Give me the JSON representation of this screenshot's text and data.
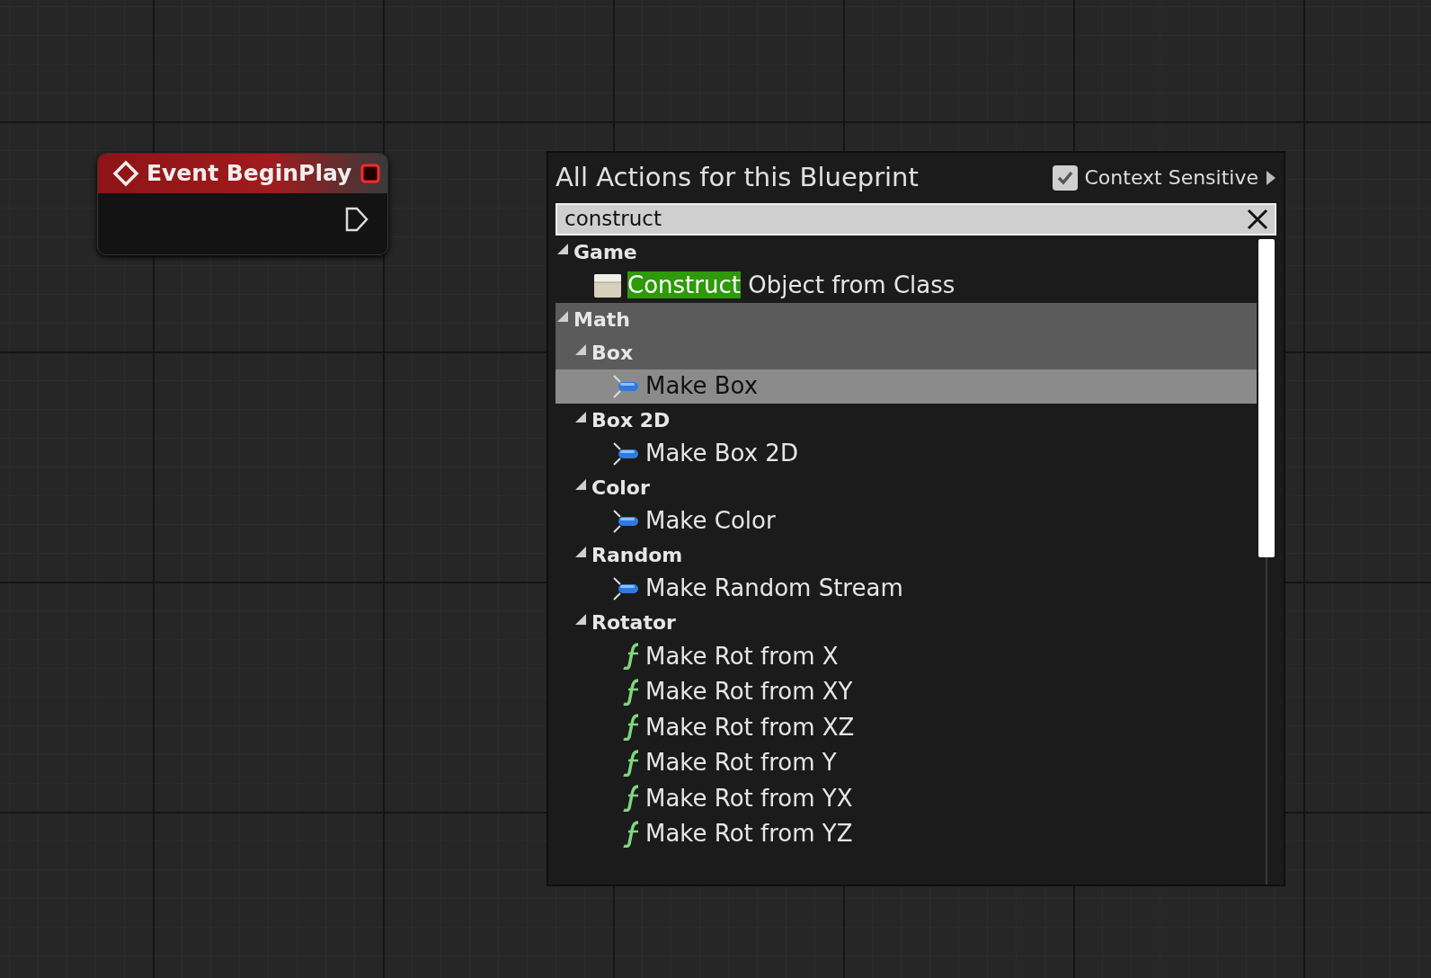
{
  "event_node": {
    "title": "Event BeginPlay"
  },
  "action_menu": {
    "title": "All Actions for this Blueprint",
    "context_sensitive": {
      "label": "Context Sensitive",
      "checked": true
    },
    "search": {
      "value": "construct"
    },
    "tree": [
      {
        "label": "Game",
        "selected": false,
        "children": [
          {
            "kind": "class",
            "selected": false,
            "parts": [
              {
                "text": "Construct",
                "match": true
              },
              {
                "text": " Object from Class",
                "match": false
              }
            ]
          }
        ]
      },
      {
        "label": "Math",
        "selected": false,
        "children": [
          {
            "label": "Box",
            "selected": false,
            "children": [
              {
                "kind": "struct",
                "selected": true,
                "parts": [
                  {
                    "text": "Make Box",
                    "match": false
                  }
                ]
              }
            ]
          },
          {
            "label": "Box 2D",
            "selected": false,
            "children": [
              {
                "kind": "struct",
                "selected": false,
                "parts": [
                  {
                    "text": "Make Box 2D",
                    "match": false
                  }
                ]
              }
            ]
          },
          {
            "label": "Color",
            "selected": false,
            "children": [
              {
                "kind": "struct",
                "selected": false,
                "parts": [
                  {
                    "text": "Make Color",
                    "match": false
                  }
                ]
              }
            ]
          },
          {
            "label": "Random",
            "selected": false,
            "children": [
              {
                "kind": "struct",
                "selected": false,
                "parts": [
                  {
                    "text": "Make Random Stream",
                    "match": false
                  }
                ]
              }
            ]
          },
          {
            "label": "Rotator",
            "selected": false,
            "children": [
              {
                "kind": "function",
                "selected": false,
                "parts": [
                  {
                    "text": "Make Rot from X",
                    "match": false
                  }
                ]
              },
              {
                "kind": "function",
                "selected": false,
                "parts": [
                  {
                    "text": "Make Rot from XY",
                    "match": false
                  }
                ]
              },
              {
                "kind": "function",
                "selected": false,
                "parts": [
                  {
                    "text": "Make Rot from XZ",
                    "match": false
                  }
                ]
              },
              {
                "kind": "function",
                "selected": false,
                "parts": [
                  {
                    "text": "Make Rot from Y",
                    "match": false
                  }
                ]
              },
              {
                "kind": "function",
                "selected": false,
                "parts": [
                  {
                    "text": "Make Rot from YX",
                    "match": false
                  }
                ]
              },
              {
                "kind": "function",
                "selected": false,
                "parts": [
                  {
                    "text": "Make Rot from YZ",
                    "match": false
                  }
                ]
              }
            ]
          }
        ]
      }
    ]
  }
}
